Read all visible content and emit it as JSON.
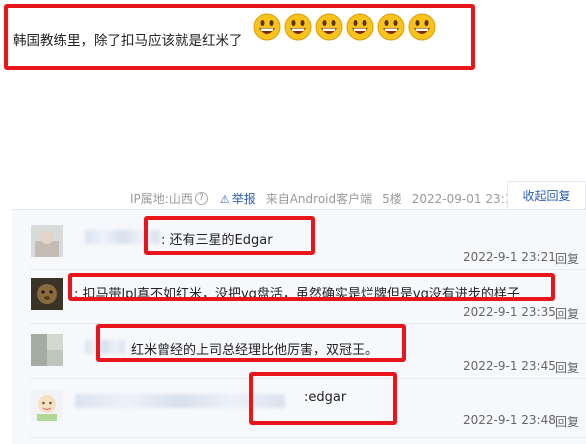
{
  "post": {
    "text": "韩国教练里，除了扣马应该就是红米了",
    "emoji_count": 6,
    "emoji_icon": "grinning-face-icon"
  },
  "meta": {
    "ip_label": "IP属地:山西",
    "report": "举报",
    "source": "来自Android客户端",
    "floor": "5楼",
    "time": "2022-09-01 23:19"
  },
  "collapse_label": "收起回复",
  "replies": [
    {
      "text": ": 还有三星的Edgar",
      "time": "2022-9-1 23:21",
      "reply_label": "回复"
    },
    {
      "text": ": 扣马带lpl真不如红米，没把vg盘活，虽然确实是烂牌但是vg没有进步的样子",
      "time": "2022-9-1 23:35",
      "reply_label": "回复"
    },
    {
      "text": "红米曾经的上司总经理比他厉害，双冠王。",
      "time": "2022-9-1 23:45",
      "reply_label": "回复"
    },
    {
      "text": ":edgar",
      "time": "2022-9-1 23:48",
      "reply_label": "回复"
    }
  ],
  "colors": {
    "highlight": "#e8161b",
    "link": "#2a5fb4",
    "reply_bg": "#f6f8fb"
  }
}
